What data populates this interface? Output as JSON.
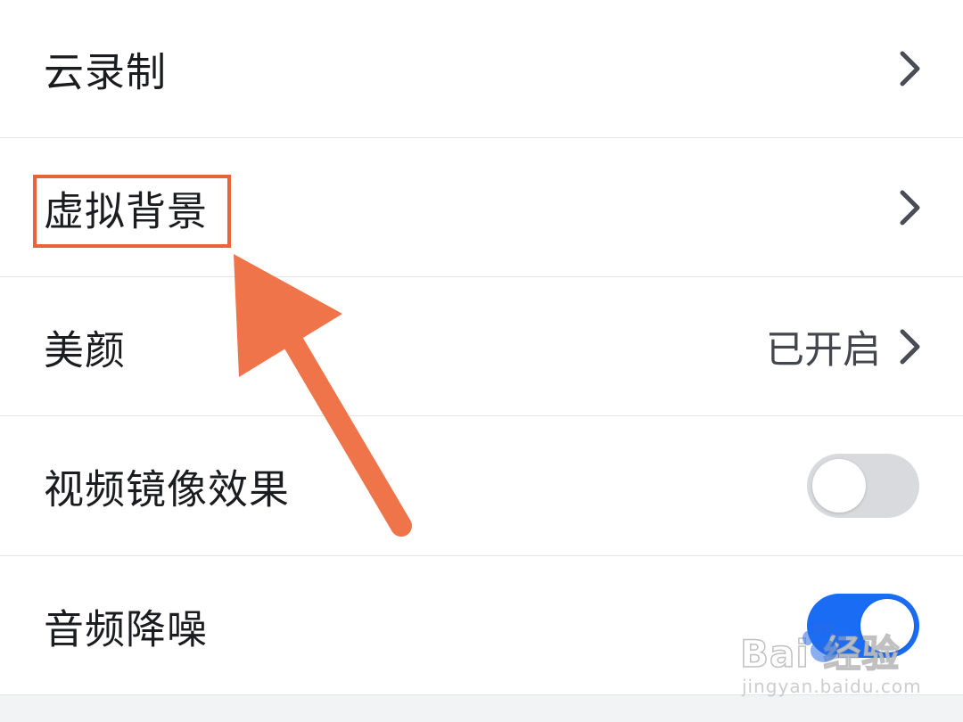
{
  "settings": {
    "rows": [
      {
        "label": "云录制",
        "control": "chevron"
      },
      {
        "label": "虚拟背景",
        "control": "chevron"
      },
      {
        "label": "美颜",
        "value": "已开启",
        "control": "chevron"
      },
      {
        "label": "视频镜像效果",
        "control": "toggle",
        "toggle_on": false
      },
      {
        "label": "音频降噪",
        "control": "toggle",
        "toggle_on": true
      }
    ]
  },
  "annotation": {
    "highlight_color": "#e9643a",
    "arrow_color": "#f0744a"
  },
  "colors": {
    "toggle_on": "#1a6cf5",
    "toggle_off": "#d9dadd",
    "divider": "#e3e4e7",
    "chevron": "#4a4c55"
  },
  "watermark": {
    "brand": "Bai  经验",
    "url": "jingyan.baidu.com",
    "icon": "paw-icon"
  }
}
